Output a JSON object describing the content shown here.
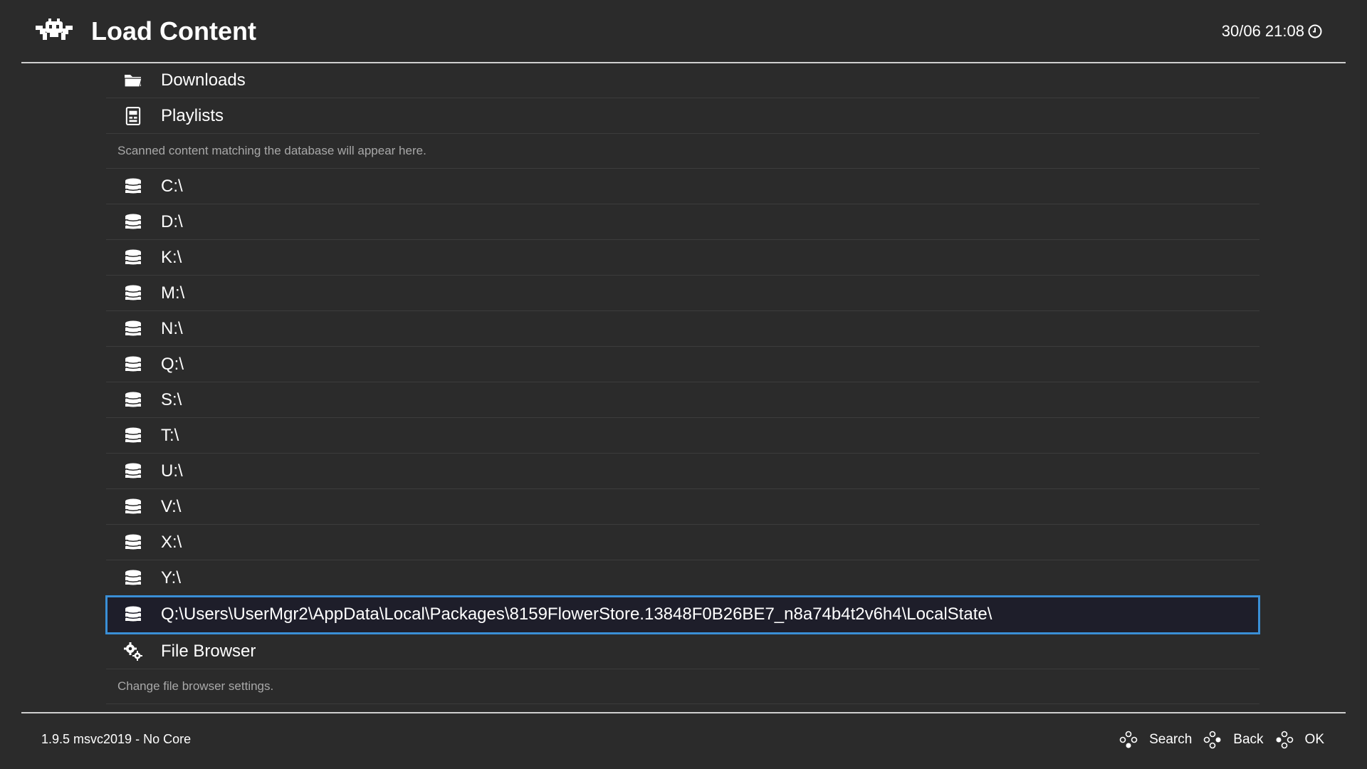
{
  "header": {
    "title": "Load Content",
    "clock": "30/06 21:08"
  },
  "list": {
    "downloads_label": "Downloads",
    "playlists_label": "Playlists",
    "playlists_description": "Scanned content matching the database will appear here.",
    "drives": [
      "C:\\",
      "D:\\",
      "K:\\",
      "M:\\",
      "N:\\",
      "Q:\\",
      "S:\\",
      "T:\\",
      "U:\\",
      "V:\\",
      "X:\\",
      "Y:\\"
    ],
    "selected_path": "Q:\\Users\\UserMgr2\\AppData\\Local\\Packages\\8159FlowerStore.13848F0B26BE7_n8a74b4t2v6h4\\LocalState\\",
    "file_browser_label": "File Browser",
    "file_browser_description": "Change file browser settings."
  },
  "footer": {
    "version": "1.9.5 msvc2019 - No Core",
    "hints": {
      "search": "Search",
      "back": "Back",
      "ok": "OK"
    }
  },
  "colors": {
    "background": "#2b2b2b",
    "selection_border": "#3a8fd6",
    "description_text": "#a8a8a8"
  },
  "icons": {
    "logo": "retroarch-invader-icon",
    "folder": "folder-icon",
    "playlist": "playlist-icon",
    "drive": "drive-stack-icon",
    "settings": "gears-icon",
    "clock": "clock-icon",
    "gamepad": "gamepad-dpad-icon"
  }
}
